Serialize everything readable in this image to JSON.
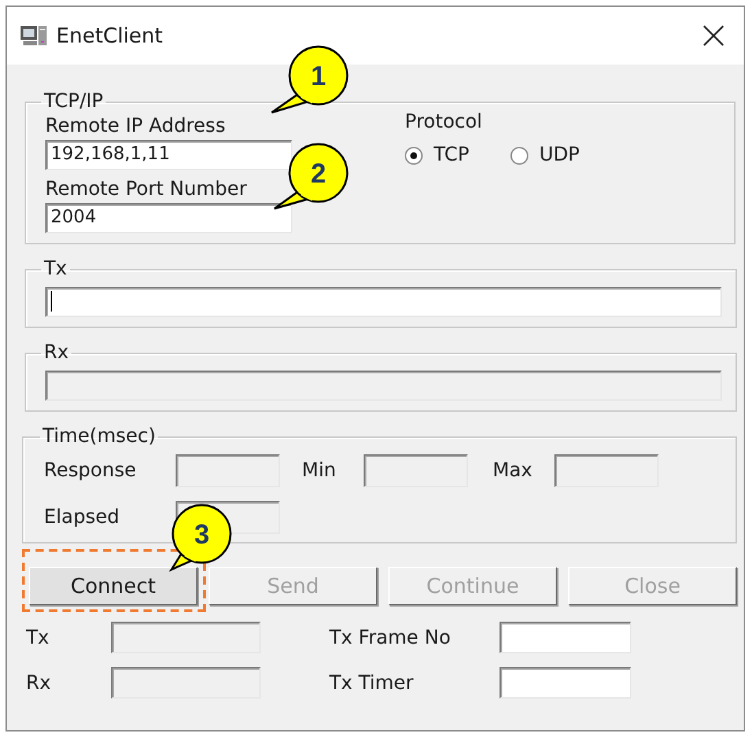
{
  "window": {
    "title": "EnetClient"
  },
  "tcp_ip": {
    "title": "TCP/IP",
    "ip_label": "Remote IP Address",
    "ip_value": "192,168,1,11",
    "port_label": "Remote Port Number",
    "port_value": "2004",
    "protocol": {
      "label": "Protocol",
      "options": [
        {
          "label": "TCP",
          "selected": true
        },
        {
          "label": "UDP",
          "selected": false
        }
      ]
    }
  },
  "tx": {
    "title": "Tx",
    "focused": true
  },
  "rx": {
    "title": "Rx",
    "disabled": true
  },
  "time": {
    "title": "Time(msec)",
    "fields": [
      {
        "label": "Response"
      },
      {
        "label": "Min"
      },
      {
        "label": "Max"
      },
      {
        "label": "Elapsed"
      }
    ]
  },
  "buttons": [
    {
      "label": "Connect",
      "disabled": false,
      "highlighted": true
    },
    {
      "label": "Send",
      "disabled": true,
      "highlighted": false
    },
    {
      "label": "Continue",
      "disabled": true,
      "highlighted": false
    },
    {
      "label": "Close",
      "disabled": true,
      "highlighted": false
    }
  ],
  "counters": [
    {
      "label": "Tx",
      "disabled": true
    },
    {
      "label": "Rx",
      "disabled": true
    }
  ],
  "frame_fields": [
    {
      "label": "Tx Frame No",
      "disabled": false
    },
    {
      "label": "Tx Timer",
      "disabled": false
    }
  ],
  "callouts": [
    {
      "number": "1"
    },
    {
      "number": "2"
    },
    {
      "number": "3"
    }
  ]
}
